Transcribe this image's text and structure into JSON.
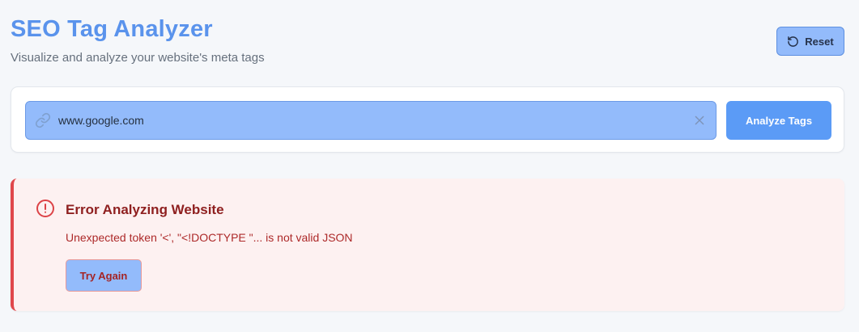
{
  "header": {
    "title": "SEO Tag Analyzer",
    "subtitle": "Visualize and analyze your website's meta tags",
    "reset_label": "Reset",
    "reset_icon": "rotate-ccw-icon"
  },
  "search": {
    "value": "www.google.com",
    "link_icon": "link-icon",
    "clear_icon": "close-icon",
    "analyze_label": "Analyze Tags"
  },
  "error": {
    "icon": "alert-circle-icon",
    "title": "Error Analyzing Website",
    "message": "Unexpected token '<', \"<!DOCTYPE \"... is not valid JSON",
    "retry_label": "Try Again"
  },
  "colors": {
    "accent": "#5a93ec",
    "primary_button": "#5b9bf6",
    "input_fill": "#93bbfb",
    "error_border": "#e0474b",
    "error_text": "#8f2020",
    "error_bg": "#fdf1f1"
  }
}
